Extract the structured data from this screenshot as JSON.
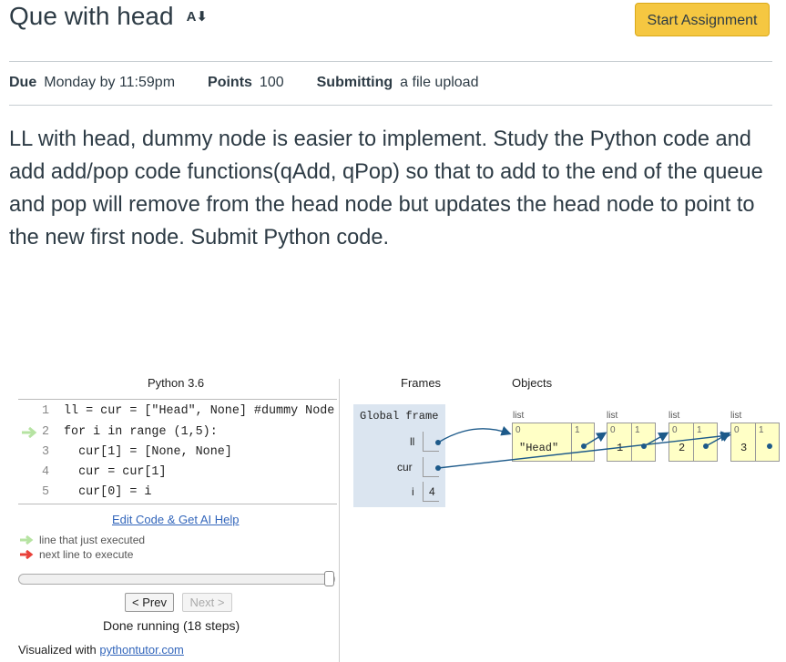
{
  "header": {
    "title": "Que with head",
    "start_button": "Start Assignment"
  },
  "meta": {
    "due_label": "Due",
    "due_value": "Monday by 11:59pm",
    "points_label": "Points",
    "points_value": "100",
    "submitting_label": "Submitting",
    "submitting_value": "a file upload"
  },
  "description": "LL with head, dummy node is easier to implement. Study the Python code and add add/pop code functions(qAdd, qPop) so that to add to the end of the queue and pop will remove from the head node but updates the head node to point to the new first node. Submit Python code.",
  "tutor": {
    "language": "Python 3.6",
    "code_lines": [
      {
        "num": "1",
        "text": "ll = cur = [\"Head\", None] #dummy Node"
      },
      {
        "num": "2",
        "text": "for i in range (1,5):"
      },
      {
        "num": "3",
        "text": "  cur[1] = [None, None]"
      },
      {
        "num": "4",
        "text": "  cur = cur[1]"
      },
      {
        "num": "5",
        "text": "  cur[0] = i"
      }
    ],
    "edit_link": "Edit Code & Get AI Help",
    "legend_executed": "line that just executed",
    "legend_next": "next line to execute",
    "prev_button": "< Prev",
    "next_button": "Next >",
    "status": "Done running (18 steps)",
    "visualized_prefix": "Visualized with",
    "visualized_link": "pythontutor.com",
    "frames_header": "Frames",
    "objects_header": "Objects",
    "global_frame": "Global frame",
    "vars": [
      {
        "name": "ll"
      },
      {
        "name": "cur"
      },
      {
        "name": "i",
        "value": "4"
      }
    ],
    "list_label": "list",
    "lists": [
      {
        "idx0": "0",
        "idx1": "1",
        "val0": "\"Head\""
      },
      {
        "idx0": "0",
        "idx1": "1",
        "val0": "1"
      },
      {
        "idx0": "0",
        "idx1": "1",
        "val0": "2"
      },
      {
        "idx0": "0",
        "idx1": "1",
        "val0": "3"
      }
    ],
    "colors": {
      "pointer": "#1d5a8a",
      "frame_bg": "#dbe5f0",
      "list_bg": "#ffffc6",
      "executed_arrow": "#b6e3a2",
      "next_arrow": "#e8413a"
    }
  }
}
